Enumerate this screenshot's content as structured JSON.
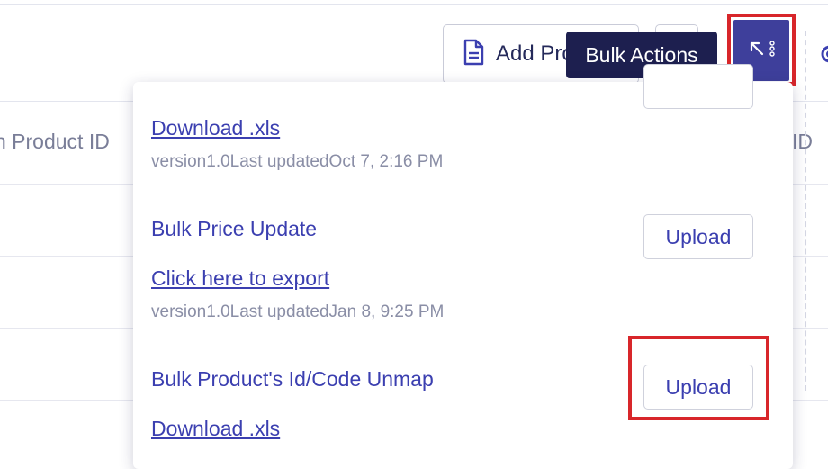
{
  "toolbar": {
    "add_product_label": "Add Pro",
    "tooltip": "Bulk Actions"
  },
  "table": {
    "col_left_header": "n Product ID",
    "col_right_header": "ID"
  },
  "bulk_menu": {
    "sections": [
      {
        "link": "Download .xls",
        "version": "version1.0",
        "updated_label": "Last updated",
        "updated_time": "Oct 7, 2:16 PM"
      },
      {
        "title": "Bulk Price Update",
        "upload_label": "Upload",
        "link": "Click here to export",
        "version": "version1.0",
        "updated_label": "Last updated",
        "updated_time": "Jan 8, 9:25 PM"
      },
      {
        "title": "Bulk Product's Id/Code Unmap",
        "upload_label": "Upload",
        "link": "Download .xls"
      }
    ]
  },
  "colors": {
    "accent": "#3e3f9b",
    "link": "#3b3fb0",
    "highlight": "#d8262a",
    "tooltip_bg": "#1d1f4f"
  },
  "icons": [
    "document-icon",
    "arrow-up-left-icon",
    "kebab-menu-icon",
    "gear-icon"
  ]
}
